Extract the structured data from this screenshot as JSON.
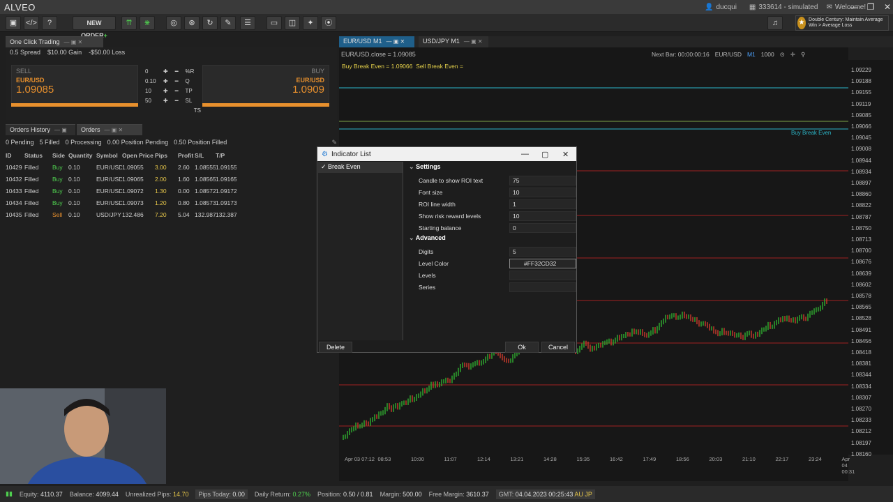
{
  "app": {
    "title": "ALVEO"
  },
  "titlebar": {
    "user": "ducqui",
    "account": "333614 - simulated",
    "welcome": "Welcome!",
    "minimize": "—",
    "restore": "❐",
    "close": "✕"
  },
  "toolbar": {
    "new_order_label": "NEW ORDER"
  },
  "news": {
    "text": "Double Century: Maintain Average Win > Average Loss"
  },
  "one_click": {
    "tab_label": "One Click Trading",
    "spread": "0.5 Spread",
    "gain": "$10.00 Gain",
    "loss": "-$50.00 Loss",
    "sell_label": "SELL",
    "buy_label": "BUY",
    "symbol": "EUR/USD",
    "sell_price": "1.09085",
    "buy_price": "1.0909",
    "rows": [
      {
        "value": "0",
        "unit": "%R"
      },
      {
        "value": "0.10",
        "unit": "Q"
      },
      {
        "value": "10",
        "unit": "TP"
      },
      {
        "value": "50",
        "unit": "SL"
      },
      {
        "value": "",
        "unit": "TS"
      }
    ]
  },
  "orders_tabs": {
    "history": "Orders History",
    "orders": "Orders"
  },
  "orders_summary": {
    "pending": "0 Pending",
    "filled": "5 Filled",
    "processing": "0 Processing",
    "position_pending": "0.00 Position Pending",
    "position_filled": "0.50 Position Filled"
  },
  "orders": {
    "headers": [
      "ID",
      "Status",
      "Side",
      "Quantity",
      "Symbol",
      "Open Price",
      "Pips",
      "Profit",
      "S/L",
      "T/P"
    ],
    "rows": [
      [
        "10429",
        "Filled",
        "Buy",
        "0.10",
        "EUR/USD",
        "1.09055",
        "3.00",
        "2.60",
        "1.08555",
        "1.09155"
      ],
      [
        "10432",
        "Filled",
        "Buy",
        "0.10",
        "EUR/USD",
        "1.09065",
        "2.00",
        "1.60",
        "1.08565",
        "1.09165"
      ],
      [
        "10433",
        "Filled",
        "Buy",
        "0.10",
        "EUR/USD",
        "1.09072",
        "1.30",
        "0.00",
        "1.08572",
        "1.09172"
      ],
      [
        "10434",
        "Filled",
        "Buy",
        "0.10",
        "EUR/USD",
        "1.09073",
        "1.20",
        "0.80",
        "1.08573",
        "1.09173"
      ],
      [
        "10435",
        "Filled",
        "Sell",
        "0.10",
        "USD/JPY",
        "132.486",
        "7.20",
        "5.04",
        "132.987",
        "132.387"
      ]
    ]
  },
  "chart": {
    "tab1": "EUR/USD M1",
    "tab2": "USD/JPY M1",
    "caption": "EUR/USD.close = 1.09085",
    "next_bar": "Next Bar: 00:00:00:16",
    "symbol": "EUR/USD",
    "timeframe": "M1",
    "bars": "1000",
    "buy_be": "Buy Break Even = 1.09066",
    "sell_be": "Sell Break Even =",
    "buy_be_tag": "Buy Break Even",
    "price_labels": [
      "1.09229",
      "1.09188",
      "1.09155",
      "1.09119",
      "1.09085",
      "1.09066",
      "1.09045",
      "1.09008",
      "1.08944",
      "1.08934",
      "1.08897",
      "1.08860",
      "1.08822",
      "1.08787",
      "1.08750",
      "1.08713",
      "1.08700",
      "1.08676",
      "1.08639",
      "1.08602",
      "1.08578",
      "1.08565",
      "1.08528",
      "1.08491",
      "1.08456",
      "1.08418",
      "1.08381",
      "1.08344",
      "1.08334",
      "1.08307",
      "1.08270",
      "1.08233",
      "1.08212",
      "1.08197",
      "1.08160"
    ],
    "time_labels": [
      "Apr 03 07:12",
      "08:53",
      "10:00",
      "11:07",
      "12:14",
      "13:21",
      "14:28",
      "15:35",
      "16:42",
      "17:49",
      "18:56",
      "20:03",
      "21:10",
      "22:17",
      "23:24",
      "Apr 04 00:31"
    ]
  },
  "dialog": {
    "title": "Indicator List",
    "item": "Break Even",
    "sections": {
      "settings": "Settings",
      "advanced": "Advanced"
    },
    "settings": [
      {
        "name": "Candle to show ROI text",
        "value": "75"
      },
      {
        "name": "Font size",
        "value": "10"
      },
      {
        "name": "ROI line width",
        "value": "1"
      },
      {
        "name": "Show risk reward levels",
        "value": "10"
      },
      {
        "name": "Starting balance",
        "value": "0"
      }
    ],
    "advanced": [
      {
        "name": "Digits",
        "value": "5"
      },
      {
        "name": "Level Color",
        "value": "#FF32CD32"
      },
      {
        "name": "Levels",
        "value": ""
      },
      {
        "name": "Series",
        "value": ""
      }
    ],
    "delete": "Delete",
    "ok": "Ok",
    "cancel": "Cancel"
  },
  "status": {
    "equity_label": "Equity:",
    "equity": "4110.37",
    "balance_label": "Balance:",
    "balance": "4099.44",
    "upips_label": "Unrealized Pips:",
    "upips": "14.70",
    "pips_today_label": "Pips Today:",
    "pips_today": "0.00",
    "daily_return_label": "Daily Return:",
    "daily_return": "0.27%",
    "position_label": "Position:",
    "position": "0.50 / 0.81",
    "margin_label": "Margin:",
    "margin": "500.00",
    "free_margin_label": "Free Margin:",
    "free_margin": "3610.37",
    "gmt_label": "GMT:",
    "gmt": "04.04.2023 00:25:43",
    "region": "AU JP"
  },
  "colors": {
    "accent": "#e8902d",
    "bull": "#2fa52f",
    "bear": "#c0392b",
    "cyan": "#2bb6c8"
  }
}
